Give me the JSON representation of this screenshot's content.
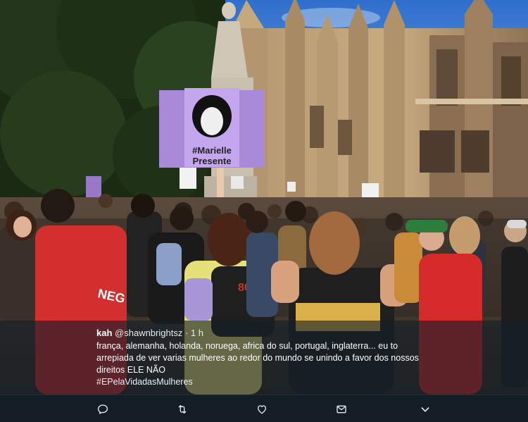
{
  "sign": {
    "hashtag_line1": "#Marielle",
    "hashtag_line2": "Presente"
  },
  "jacket_print": "NEG",
  "shirt_print": "80",
  "tweet": {
    "name": "kah",
    "handle": "@shawnbrightsz",
    "separator": "·",
    "time": "1 h",
    "text": "frança, alemanha, holanda, noruega, africa do sul, portugal, inglaterra...  eu to arrepiada de ver varias mulheres ao redor do mundo se unindo a favor dos nossos direitos ELE NÃO",
    "hashtag": "#EPelaVidadasMulheres"
  },
  "actions": [
    {
      "name": "reply",
      "icon": "reply-icon"
    },
    {
      "name": "retweet",
      "icon": "retweet-icon"
    },
    {
      "name": "like",
      "icon": "heart-icon"
    },
    {
      "name": "message",
      "icon": "envelope-icon"
    },
    {
      "name": "more",
      "icon": "chevron-down-icon"
    }
  ],
  "colors": {
    "sky": "#3d7fd6",
    "sign": "#a98ad8",
    "caption_bg": "#141e28",
    "action_bar": "#141d26",
    "icon": "#e6ecf0"
  }
}
